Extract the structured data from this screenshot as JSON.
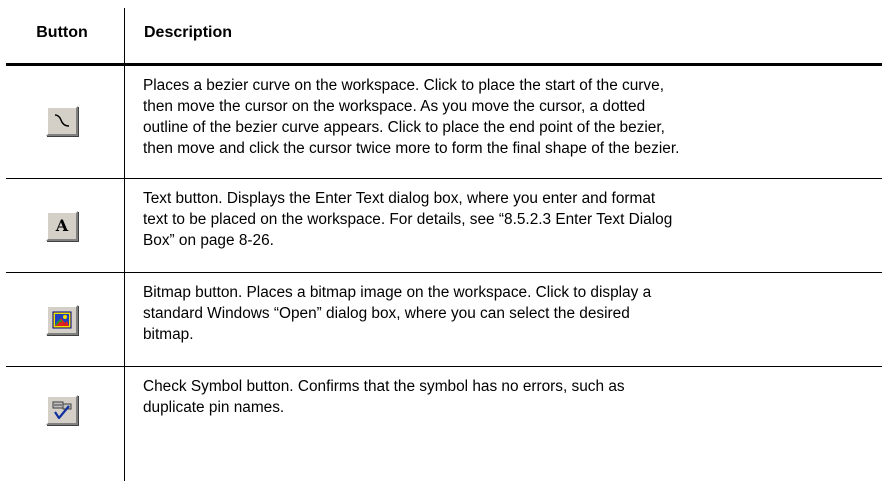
{
  "table": {
    "headers": {
      "button": "Button",
      "description": "Description"
    },
    "rows": [
      {
        "icon": "bezier-curve-icon",
        "description": "Places a bezier curve on the workspace. Click to place the start of the curve,\nthen move the cursor on the workspace. As you move the cursor, a dotted\noutline of the bezier curve appears. Click to place the end point of the bezier,\nthen move and click the cursor twice more to form the final shape of the bezier."
      },
      {
        "icon": "text-icon",
        "glyph": "A",
        "description": "Text button. Displays the Enter Text dialog box, where you enter and format\ntext to be placed on the workspace. For details, see “8.5.2.3 Enter Text Dialog\nBox” on page 8-26."
      },
      {
        "icon": "bitmap-icon",
        "description": "Bitmap button. Places a bitmap image on the workspace. Click to display a\nstandard Windows “Open” dialog box, where you can select the desired\nbitmap."
      },
      {
        "icon": "check-symbol-icon",
        "description": "Check Symbol button. Confirms that the symbol has no errors, such as\nduplicate pin names."
      }
    ]
  }
}
